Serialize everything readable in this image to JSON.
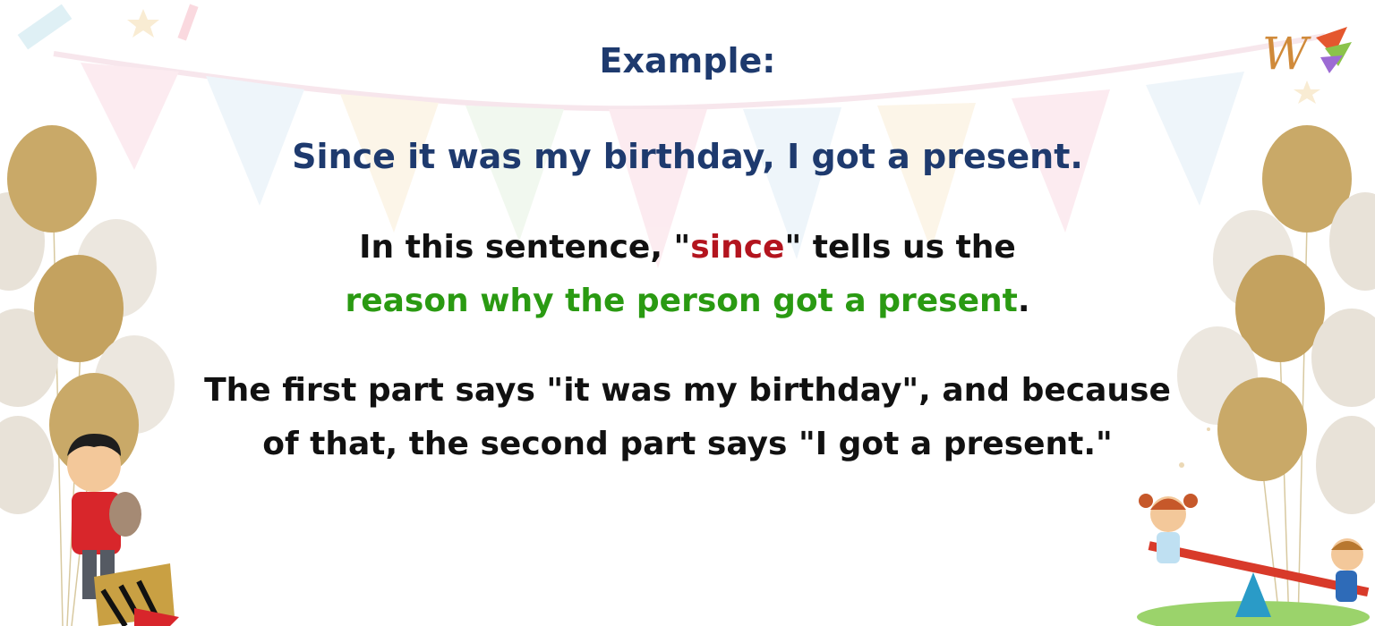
{
  "title": "Example:",
  "example_sentence": "Since it was my birthday, I got a present.",
  "explanation": {
    "part1": "In this sentence, \"",
    "keyword": "since",
    "part2": "\" tells us the ",
    "reason": "reason why the person got a present",
    "part3": "."
  },
  "detail": {
    "line1": "The first part says \"it was my birthday\", and because",
    "line2": "of that, the second part says \"I got a present.\""
  },
  "colors": {
    "heading": "#1e3a6e",
    "keyword": "#b3141e",
    "reason": "#2a9a12",
    "body": "#111111"
  },
  "logo_letter": "W"
}
